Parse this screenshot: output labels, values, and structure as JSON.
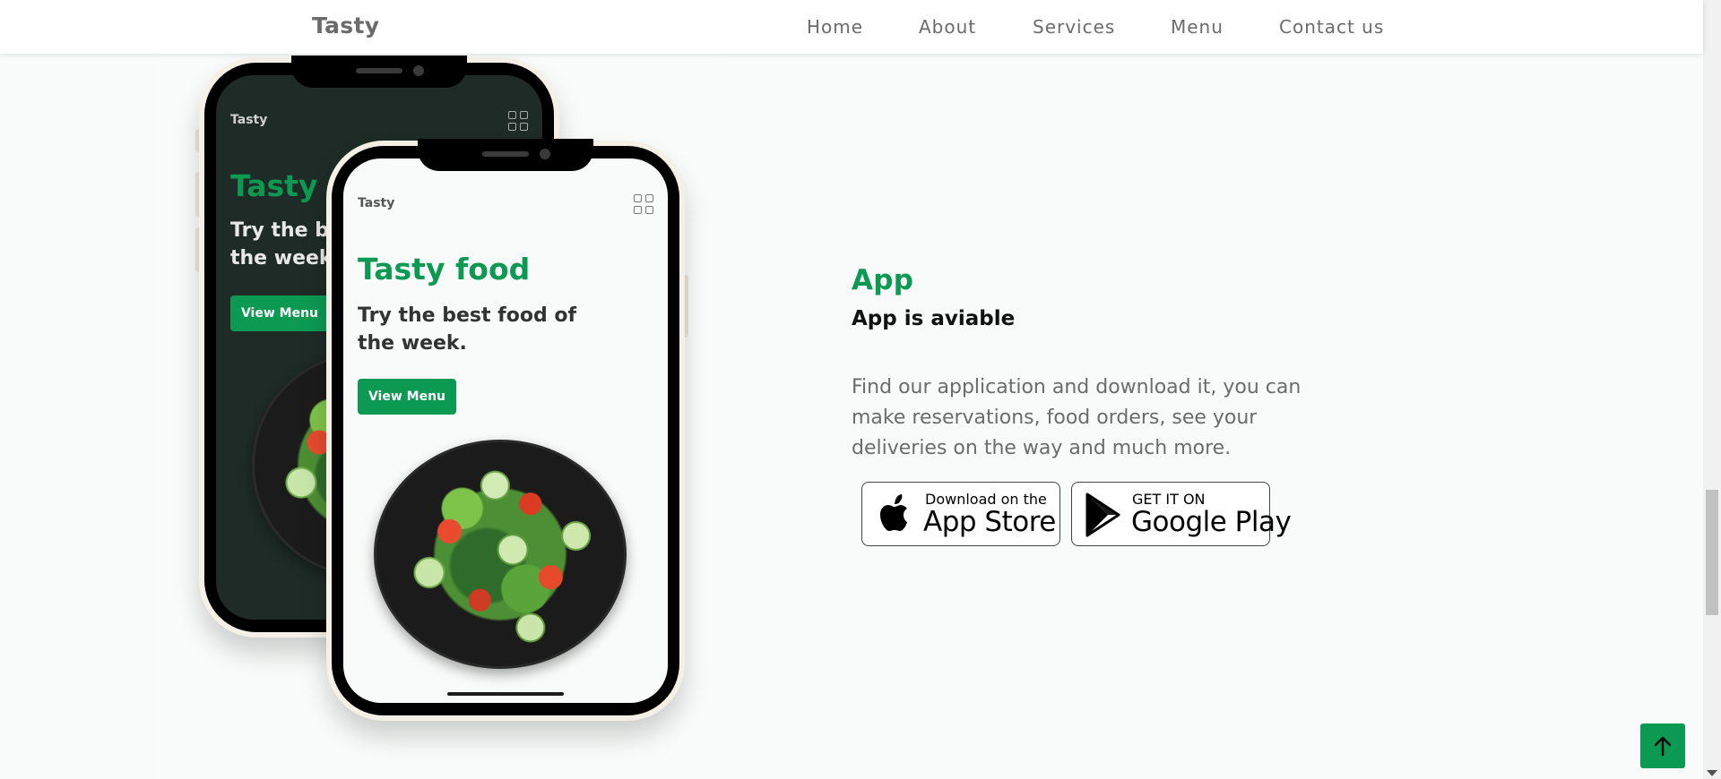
{
  "header": {
    "brand": "Tasty",
    "nav": [
      "Home",
      "About",
      "Services",
      "Menu",
      "Contact us"
    ]
  },
  "phones": {
    "brand": "Tasty",
    "title": "Tasty food",
    "title_cropped": "Tasty",
    "subtitle": "Try the best food of the week.",
    "subtitle_cropped_line1": "Try the b",
    "subtitle_cropped_line2": "the week",
    "button": "View Menu"
  },
  "app_section": {
    "label": "App",
    "heading": "App is aviable",
    "description": "Find our application and download it, you can make reservations, food orders, see your deliveries on the way and much more.",
    "app_store": {
      "small": "Download on the",
      "big": "App Store",
      "icon": "apple-icon"
    },
    "google_play": {
      "small": "GET IT ON",
      "big": "Google Play",
      "icon": "google-play-icon"
    }
  },
  "back_to_top": {
    "icon": "arrow-up-icon"
  },
  "colors": {
    "accent": "#0c9a52",
    "dark_screen": "#1e2b26",
    "text_gray": "#6b6b6b",
    "background": "#f9fbfa"
  }
}
